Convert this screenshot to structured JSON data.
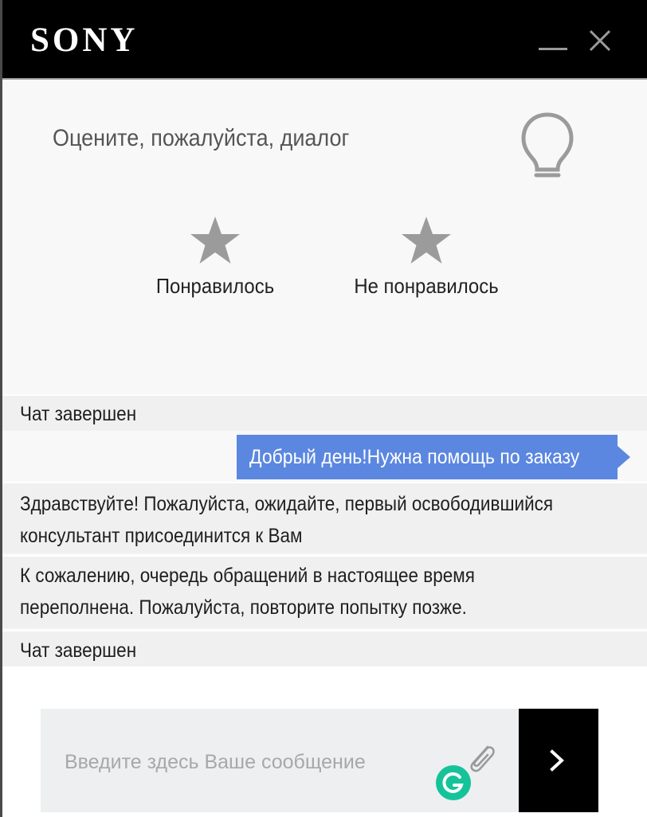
{
  "header": {
    "logo_text": "SONY",
    "minimize_icon": "minimize-icon",
    "close_icon": "close-icon",
    "background_color": "#000000"
  },
  "rating": {
    "title": "Оцените, пожалуйста, диалог",
    "bulb_icon": "lightbulb-icon",
    "options": [
      {
        "icon": "star-icon",
        "label": "Понравилось"
      },
      {
        "icon": "star-icon",
        "label": "Не понравилось"
      }
    ]
  },
  "messages": [
    {
      "type": "system",
      "text": "Чат завершен"
    },
    {
      "type": "user",
      "text": "Добрый день!Нужна помощь по заказу"
    },
    {
      "type": "system",
      "lines": [
        "Здравствуйте! Пожалуйста, ожидайте, первый освободившийся",
        "консультант присоединится к Вам"
      ]
    },
    {
      "type": "system",
      "lines": [
        "К сожалению, очередь  обращений  в настоящее время",
        "переполнена. Пожалуйста, повторите попытку позже."
      ]
    },
    {
      "type": "system",
      "text": "Чат завершен"
    }
  ],
  "composer": {
    "placeholder": "Введите здесь Ваше сообщение",
    "value": "",
    "attach_icon": "paperclip-icon",
    "grammarly_icon": "grammarly-icon",
    "send_icon": "chevron-right-icon"
  },
  "colors": {
    "accent": "#5b87e0",
    "header_bg": "#000000",
    "star": "#9b9b9b",
    "grammarly": "#15c39a"
  }
}
